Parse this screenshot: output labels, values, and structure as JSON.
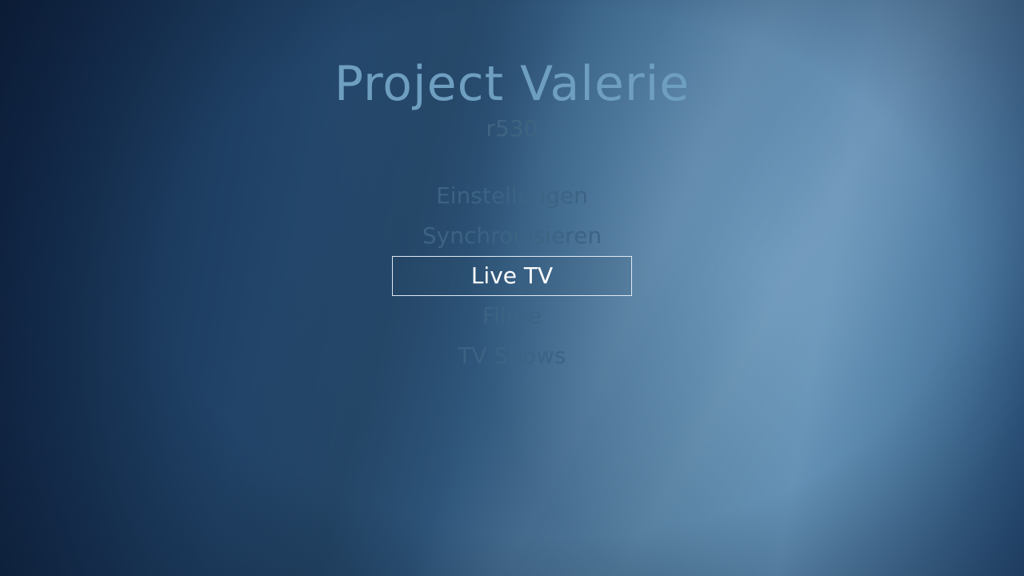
{
  "app": {
    "title": "Project Valerie",
    "version": "r530"
  },
  "menu": {
    "items": [
      {
        "label": "Einstellungen",
        "selected": false
      },
      {
        "label": "Synchronisieren",
        "selected": false
      },
      {
        "label": "Live TV",
        "selected": true
      },
      {
        "label": "Filme",
        "selected": false
      },
      {
        "label": "TV Shows",
        "selected": false
      }
    ]
  },
  "colors": {
    "title": "#6f9fc0",
    "menu_text": "#3c6383",
    "selected_text": "#ffffff",
    "selected_border": "#dfe9f2"
  }
}
